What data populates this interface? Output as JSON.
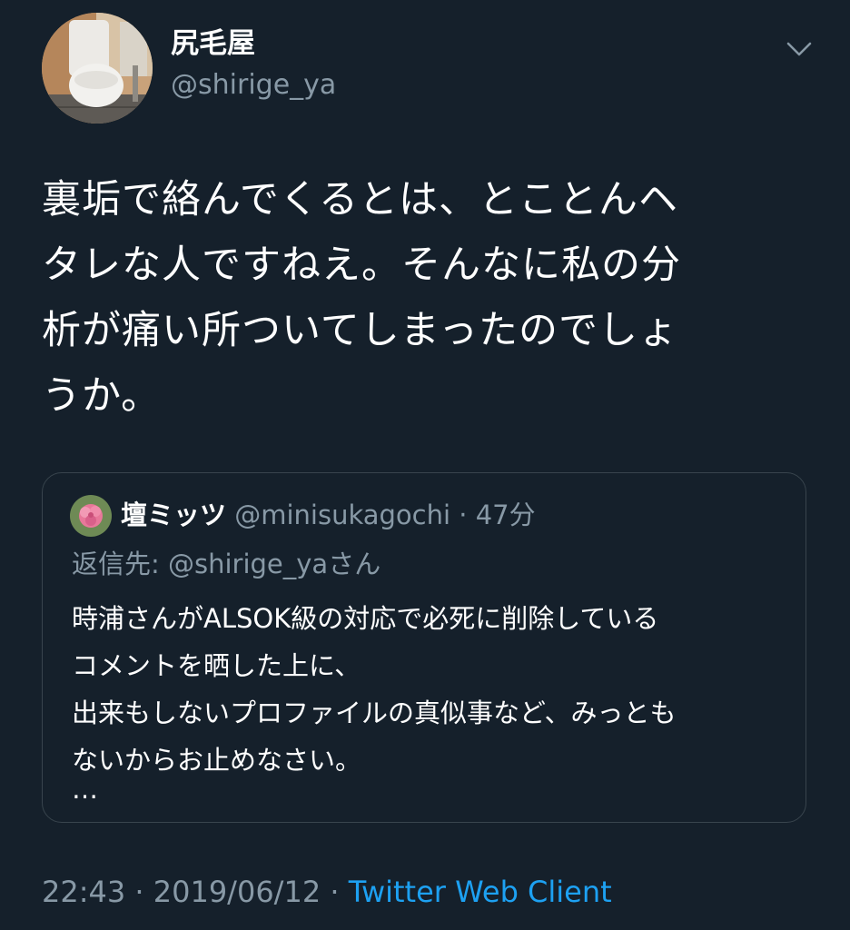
{
  "user": {
    "display_name": "尻毛屋",
    "handle": "@shirige_ya",
    "avatar_icon": "toilet-photo-avatar"
  },
  "menu": {
    "icon": "chevron-down-icon"
  },
  "tweet": {
    "lines": [
      "裏垢で絡んでくるとは、とことんヘ",
      "タレな人ですねえ。そんなに私の分",
      "析が痛い所ついてしまったのでしょ",
      "うか。"
    ]
  },
  "quoted": {
    "avatar_icon": "flower-avatar",
    "display_name": "壇ミッツ",
    "handle": "@minisukagochi",
    "separator": "·",
    "time": "47分",
    "reply_to": "返信先: @shirige_yaさん",
    "lines": [
      "時浦さんがALSOK級の対応で必死に削除している",
      "コメントを晒した上に、",
      "出来もしないプロファイルの真似事など、みっとも",
      "ないからお止めなさい。"
    ],
    "ellipsis": "…"
  },
  "meta": {
    "time": "22:43",
    "separator": "·",
    "date": "2019/06/12",
    "client": "Twitter Web Client"
  },
  "colors": {
    "background": "#15202b",
    "secondary_text": "#8899a6",
    "link": "#1da1f2",
    "border": "#38444d"
  }
}
